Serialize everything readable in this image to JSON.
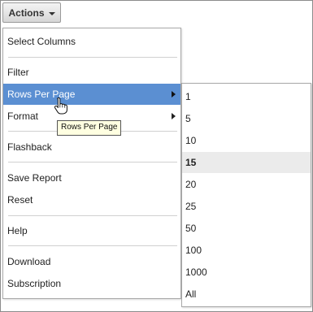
{
  "actions_button": {
    "label": "Actions"
  },
  "menu": {
    "items": [
      {
        "label": "Select Columns"
      },
      {
        "label": "Filter"
      },
      {
        "label": "Rows Per Page",
        "has_submenu": true,
        "active": true
      },
      {
        "label": "Format",
        "has_submenu": true
      },
      {
        "label": "Flashback"
      },
      {
        "label": "Save Report"
      },
      {
        "label": "Reset"
      },
      {
        "label": "Help"
      },
      {
        "label": "Download"
      },
      {
        "label": "Subscription"
      }
    ]
  },
  "submenu": {
    "items": [
      "1",
      "5",
      "10",
      "15",
      "20",
      "25",
      "50",
      "100",
      "1000",
      "All"
    ],
    "selected": "15"
  },
  "tooltip": {
    "text": "Rows Per Page"
  },
  "colors": {
    "highlight": "#5b8fd2",
    "tooltip_bg": "#ffffe1",
    "selected_bg": "#ebebeb"
  }
}
